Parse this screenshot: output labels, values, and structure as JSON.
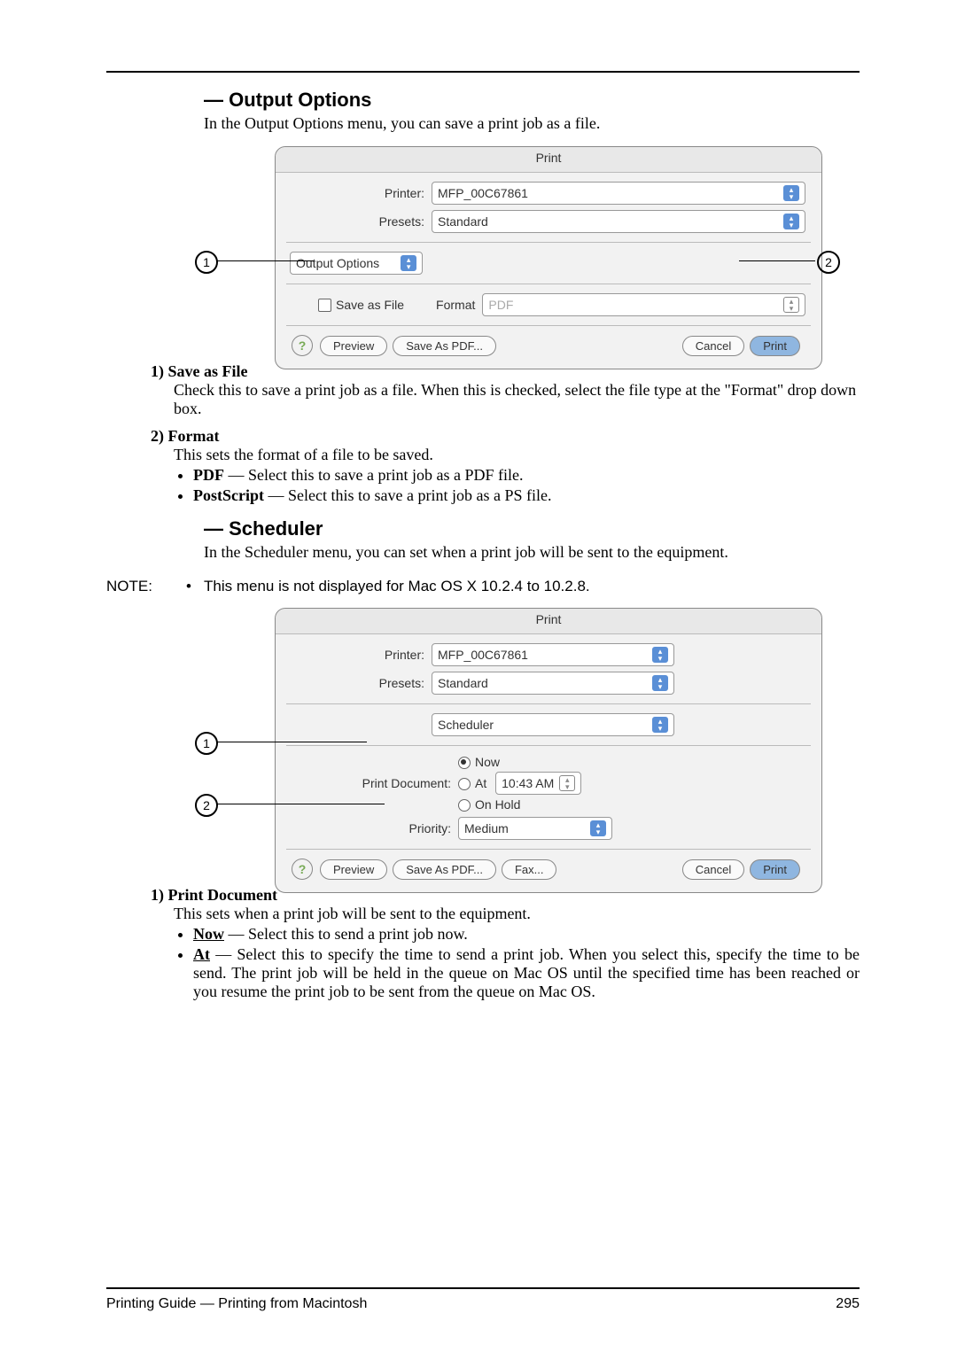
{
  "section1": {
    "heading": "— Output Options",
    "intro": "In the Output Options menu, you can save a print job as a file."
  },
  "dialog1": {
    "title": "Print",
    "printer_label": "Printer:",
    "printer_value": "MFP_00C67861",
    "presets_label": "Presets:",
    "presets_value": "Standard",
    "section_value": "Output Options",
    "save_as_file": "Save as File",
    "format_label": "Format",
    "format_value": "PDF",
    "preview": "Preview",
    "save_pdf": "Save As PDF...",
    "cancel": "Cancel",
    "print": "Print"
  },
  "items1": [
    {
      "num": "1)",
      "title": "Save as File",
      "body": "Check this to save a print job as a file.  When this is checked, select the file type at the \"Format\" drop down box."
    },
    {
      "num": "2)",
      "title": "Format",
      "body": "This sets the format of a file to be saved.",
      "bullets": [
        {
          "b": "PDF",
          "rest": " — Select this to save a print job as a PDF file."
        },
        {
          "b": "PostScript",
          "rest": " — Select this to save a print job as a PS file."
        }
      ]
    }
  ],
  "section2": {
    "heading": "— Scheduler",
    "intro": "In the Scheduler menu, you can set when a print job will be sent to the equipment."
  },
  "note": {
    "label": "NOTE:",
    "text": "This menu is not displayed for Mac OS X 10.2.4 to 10.2.8."
  },
  "dialog2": {
    "title": "Print",
    "printer_label": "Printer:",
    "printer_value": "MFP_00C67861",
    "presets_label": "Presets:",
    "presets_value": "Standard",
    "section_value": "Scheduler",
    "print_doc_label": "Print Document:",
    "opt_now": "Now",
    "opt_at": "At",
    "at_time": "10:43 AM",
    "opt_hold": "On Hold",
    "priority_label": "Priority:",
    "priority_value": "Medium",
    "preview": "Preview",
    "save_pdf": "Save As PDF...",
    "fax": "Fax...",
    "cancel": "Cancel",
    "print": "Print"
  },
  "items2": [
    {
      "num": "1)",
      "title": "Print Document",
      "body": "This sets when a print job will be sent to the equipment.",
      "bullets": [
        {
          "b": "Now",
          "under": true,
          "rest": " — Select this to send a print job now."
        },
        {
          "b": "At",
          "under": true,
          "rest": " — Select this to specify the time to send a print job.  When you select this, specify the time to be send.  The print job will be held in the queue on Mac OS until the specified time has been reached or you resume the print job to be sent from the queue on Mac OS."
        }
      ]
    }
  ],
  "footer": {
    "left": "Printing Guide — Printing from Macintosh",
    "right": "295"
  }
}
